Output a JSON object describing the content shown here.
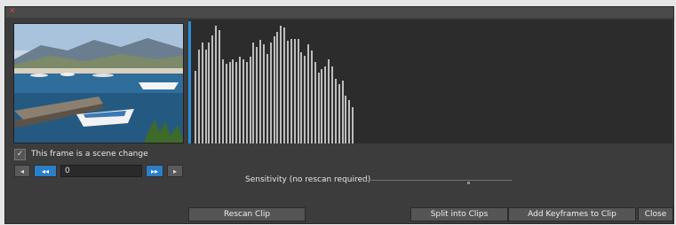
{
  "window": {
    "close_icon": "close-x-icon"
  },
  "preview": {
    "description_icon": "harbor-photo"
  },
  "scene_change": {
    "checked": true,
    "label": "This frame is a scene change"
  },
  "frame_controls": {
    "prev_label": "◂",
    "rewind_label": "◂◂",
    "frame_value": "0",
    "fast_forward_label": "▸▸",
    "next_label": "▸"
  },
  "histogram": {
    "values": [
      0.6,
      0.78,
      0.84,
      0.78,
      0.84,
      0.9,
      0.98,
      0.94,
      0.7,
      0.66,
      0.68,
      0.7,
      0.68,
      0.72,
      0.7,
      0.68,
      0.72,
      0.84,
      0.8,
      0.86,
      0.82,
      0.74,
      0.84,
      0.89,
      0.93,
      0.98,
      0.96,
      0.85,
      0.87,
      0.87,
      0.87,
      0.76,
      0.73,
      0.82,
      0.77,
      0.68,
      0.59,
      0.62,
      0.64,
      0.7,
      0.64,
      0.54,
      0.49,
      0.52,
      0.4,
      0.36,
      0.3
    ]
  },
  "sensitivity": {
    "label": "Sensitivity (no rescan required)",
    "level": 0.7
  },
  "buttons": {
    "rescan": "Rescan Clip",
    "split": "Split into Clips",
    "keyframes": "Add Keyframes to Clip",
    "close": "Close"
  },
  "colors": {
    "accent": "#2a8fd8",
    "bar": "#bdbdbd",
    "panel": "#3c3c3c"
  }
}
